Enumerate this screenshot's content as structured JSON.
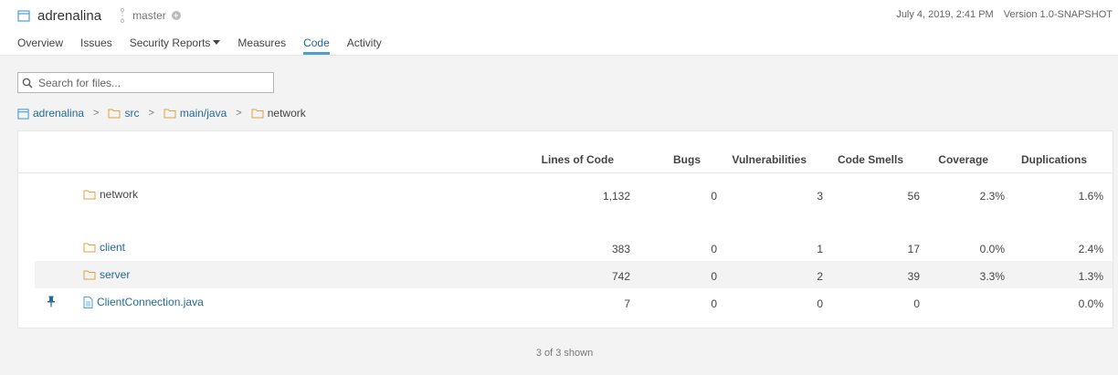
{
  "project": {
    "name": "adrenalina",
    "branch": "master"
  },
  "meta": {
    "date": "July 4, 2019, 2:41 PM",
    "version": "Version 1.0-SNAPSHOT"
  },
  "nav": {
    "tabs": [
      {
        "label": "Overview"
      },
      {
        "label": "Issues"
      },
      {
        "label": "Security Reports"
      },
      {
        "label": "Measures"
      },
      {
        "label": "Code",
        "active": true
      },
      {
        "label": "Activity"
      }
    ]
  },
  "search": {
    "placeholder": "Search for files...",
    "value": ""
  },
  "breadcrumb": [
    "adrenalina",
    "src",
    "main/java",
    "network"
  ],
  "breadcrumb_sep": ">",
  "table": {
    "columns": [
      "Lines of Code",
      "Bugs",
      "Vulnerabilities",
      "Code Smells",
      "Coverage",
      "Duplications"
    ],
    "base": {
      "name": "network",
      "loc": "1,132",
      "bugs": "0",
      "vulns": "3",
      "smells": "56",
      "coverage": "2.3%",
      "dup": "1.6%"
    },
    "rows": [
      {
        "name": "client",
        "loc": "383",
        "bugs": "0",
        "vulns": "1",
        "smells": "17",
        "coverage": "0.0%",
        "dup": "2.4%"
      },
      {
        "name": "server",
        "loc": "742",
        "bugs": "0",
        "vulns": "2",
        "smells": "39",
        "coverage": "3.3%",
        "dup": "1.3%"
      },
      {
        "name": "ClientConnection.java",
        "loc": "7",
        "bugs": "0",
        "vulns": "0",
        "smells": "0",
        "coverage": "",
        "dup": "0.0%"
      }
    ]
  },
  "footer": {
    "count": "3 of 3 shown"
  },
  "colors": {
    "link": "#236a97",
    "folder": "#e2a03f",
    "tab_active": "#4b9fd5"
  }
}
